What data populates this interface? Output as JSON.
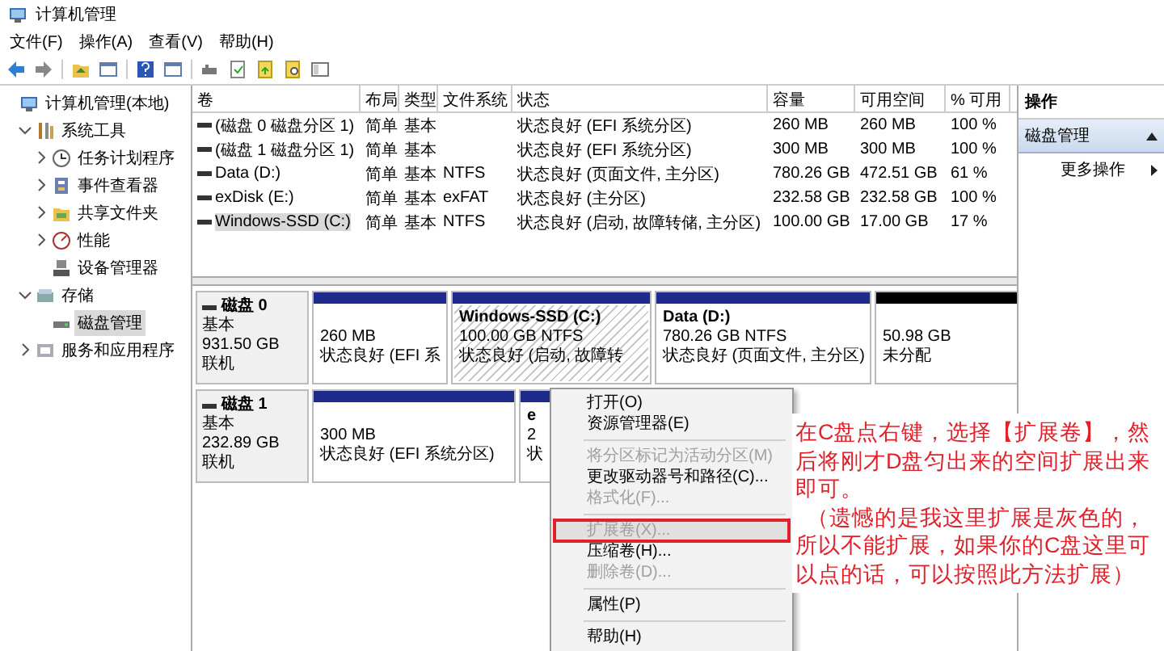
{
  "window": {
    "title": "计算机管理"
  },
  "menu": [
    "文件(F)",
    "操作(A)",
    "查看(V)",
    "帮助(H)"
  ],
  "tree": [
    {
      "label": "计算机管理(本地)",
      "selected": false,
      "children": [
        {
          "label": "系统工具",
          "expanded": true,
          "selected": false,
          "children": [
            {
              "label": "任务计划程序",
              "expanded": false,
              "selected": false
            },
            {
              "label": "事件查看器",
              "expanded": false,
              "selected": false
            },
            {
              "label": "共享文件夹",
              "expanded": false,
              "selected": false
            },
            {
              "label": "性能",
              "expanded": false,
              "selected": false
            },
            {
              "label": "设备管理器",
              "selected": false
            }
          ]
        },
        {
          "label": "存储",
          "expanded": true,
          "selected": false,
          "children": [
            {
              "label": "磁盘管理",
              "selected": true
            }
          ]
        },
        {
          "label": "服务和应用程序",
          "expanded": false,
          "selected": false
        }
      ]
    }
  ],
  "table": {
    "columns": [
      "卷",
      "布局",
      "类型",
      "文件系统",
      "状态",
      "容量",
      "可用空间",
      "% 可用"
    ],
    "rows": [
      {
        "selected": false,
        "cells": [
          "(磁盘 0 磁盘分区 1)",
          "简单",
          "基本",
          "",
          "状态良好 (EFI 系统分区)",
          "260 MB",
          "260 MB",
          "100 %"
        ]
      },
      {
        "selected": false,
        "cells": [
          "(磁盘 1 磁盘分区 1)",
          "简单",
          "基本",
          "",
          "状态良好 (EFI 系统分区)",
          "300 MB",
          "300 MB",
          "100 %"
        ]
      },
      {
        "selected": false,
        "cells": [
          "Data (D:)",
          "简单",
          "基本",
          "NTFS",
          "状态良好 (页面文件, 主分区)",
          "780.26 GB",
          "472.51 GB",
          "61 %"
        ]
      },
      {
        "selected": false,
        "cells": [
          "exDisk (E:)",
          "简单",
          "基本",
          "exFAT",
          "状态良好 (主分区)",
          "232.58 GB",
          "232.58 GB",
          "100 %"
        ]
      },
      {
        "selected": true,
        "cells": [
          "Windows-SSD (C:)",
          "简单",
          "基本",
          "NTFS",
          "状态良好 (启动, 故障转储, 主分区)",
          "100.00 GB",
          "17.00 GB",
          "17 %"
        ]
      }
    ]
  },
  "disks": [
    {
      "name": "磁盘 0",
      "type": "基本",
      "size": "931.50 GB",
      "status": "联机",
      "partitions": [
        {
          "kind": "primary",
          "selected": false,
          "lines": [
            "260 MB",
            "状态良好 (EFI 系"
          ]
        },
        {
          "kind": "primary",
          "selected": true,
          "title": "Windows-SSD  (C:)",
          "lines": [
            "100.00 GB NTFS",
            "状态良好 (启动, 故障转"
          ]
        },
        {
          "kind": "primary",
          "selected": false,
          "title": "Data  (D:)",
          "lines": [
            "780.26 GB NTFS",
            "状态良好 (页面文件, 主分区)"
          ]
        },
        {
          "kind": "unallocated",
          "selected": false,
          "lines": [
            "50.98 GB",
            "未分配"
          ]
        }
      ]
    },
    {
      "name": "磁盘 1",
      "type": "基本",
      "size": "232.89 GB",
      "status": "联机",
      "partitions": [
        {
          "kind": "primary",
          "selected": false,
          "lines": [
            "300 MB",
            "状态良好 (EFI 系统分区)"
          ]
        },
        {
          "kind": "primary",
          "selected": false,
          "title": "e",
          "lines": [
            "2",
            "状"
          ]
        }
      ]
    }
  ],
  "actions": {
    "title": "操作",
    "section": {
      "label": "磁盘管理",
      "expanded": true
    },
    "items": [
      {
        "label": "更多操作"
      }
    ]
  },
  "context_menu": {
    "items": [
      {
        "kind": "item",
        "label": "打开(O)",
        "disabled": false,
        "highlighted": false,
        "annotated": false
      },
      {
        "kind": "item",
        "label": "资源管理器(E)",
        "disabled": false,
        "highlighted": false,
        "annotated": false
      },
      {
        "kind": "separator"
      },
      {
        "kind": "item",
        "label": "将分区标记为活动分区(M)",
        "disabled": true,
        "highlighted": false,
        "annotated": false
      },
      {
        "kind": "item",
        "label": "更改驱动器号和路径(C)...",
        "disabled": false,
        "highlighted": false,
        "annotated": false
      },
      {
        "kind": "item",
        "label": "格式化(F)...",
        "disabled": true,
        "highlighted": false,
        "annotated": false
      },
      {
        "kind": "separator"
      },
      {
        "kind": "item",
        "label": "扩展卷(X)...",
        "disabled": true,
        "highlighted": true,
        "annotated": true
      },
      {
        "kind": "item",
        "label": "压缩卷(H)...",
        "disabled": false,
        "highlighted": false,
        "annotated": false
      },
      {
        "kind": "item",
        "label": "删除卷(D)...",
        "disabled": true,
        "highlighted": false,
        "annotated": false
      },
      {
        "kind": "separator"
      },
      {
        "kind": "item",
        "label": "属性(P)",
        "disabled": false,
        "highlighted": false,
        "annotated": false
      },
      {
        "kind": "separator"
      },
      {
        "kind": "item",
        "label": "帮助(H)",
        "disabled": false,
        "highlighted": false,
        "annotated": false
      }
    ]
  },
  "annotation": {
    "paragraphs": [
      "在C盘点右键，选择【扩展卷】，然后将刚才D盘匀出来的空间扩展出来即可。",
      "（遗憾的是我这里扩展是灰色的，所以不能扩展，如果你的C盘这里可以点的话，可以按照此方法扩展）"
    ]
  }
}
